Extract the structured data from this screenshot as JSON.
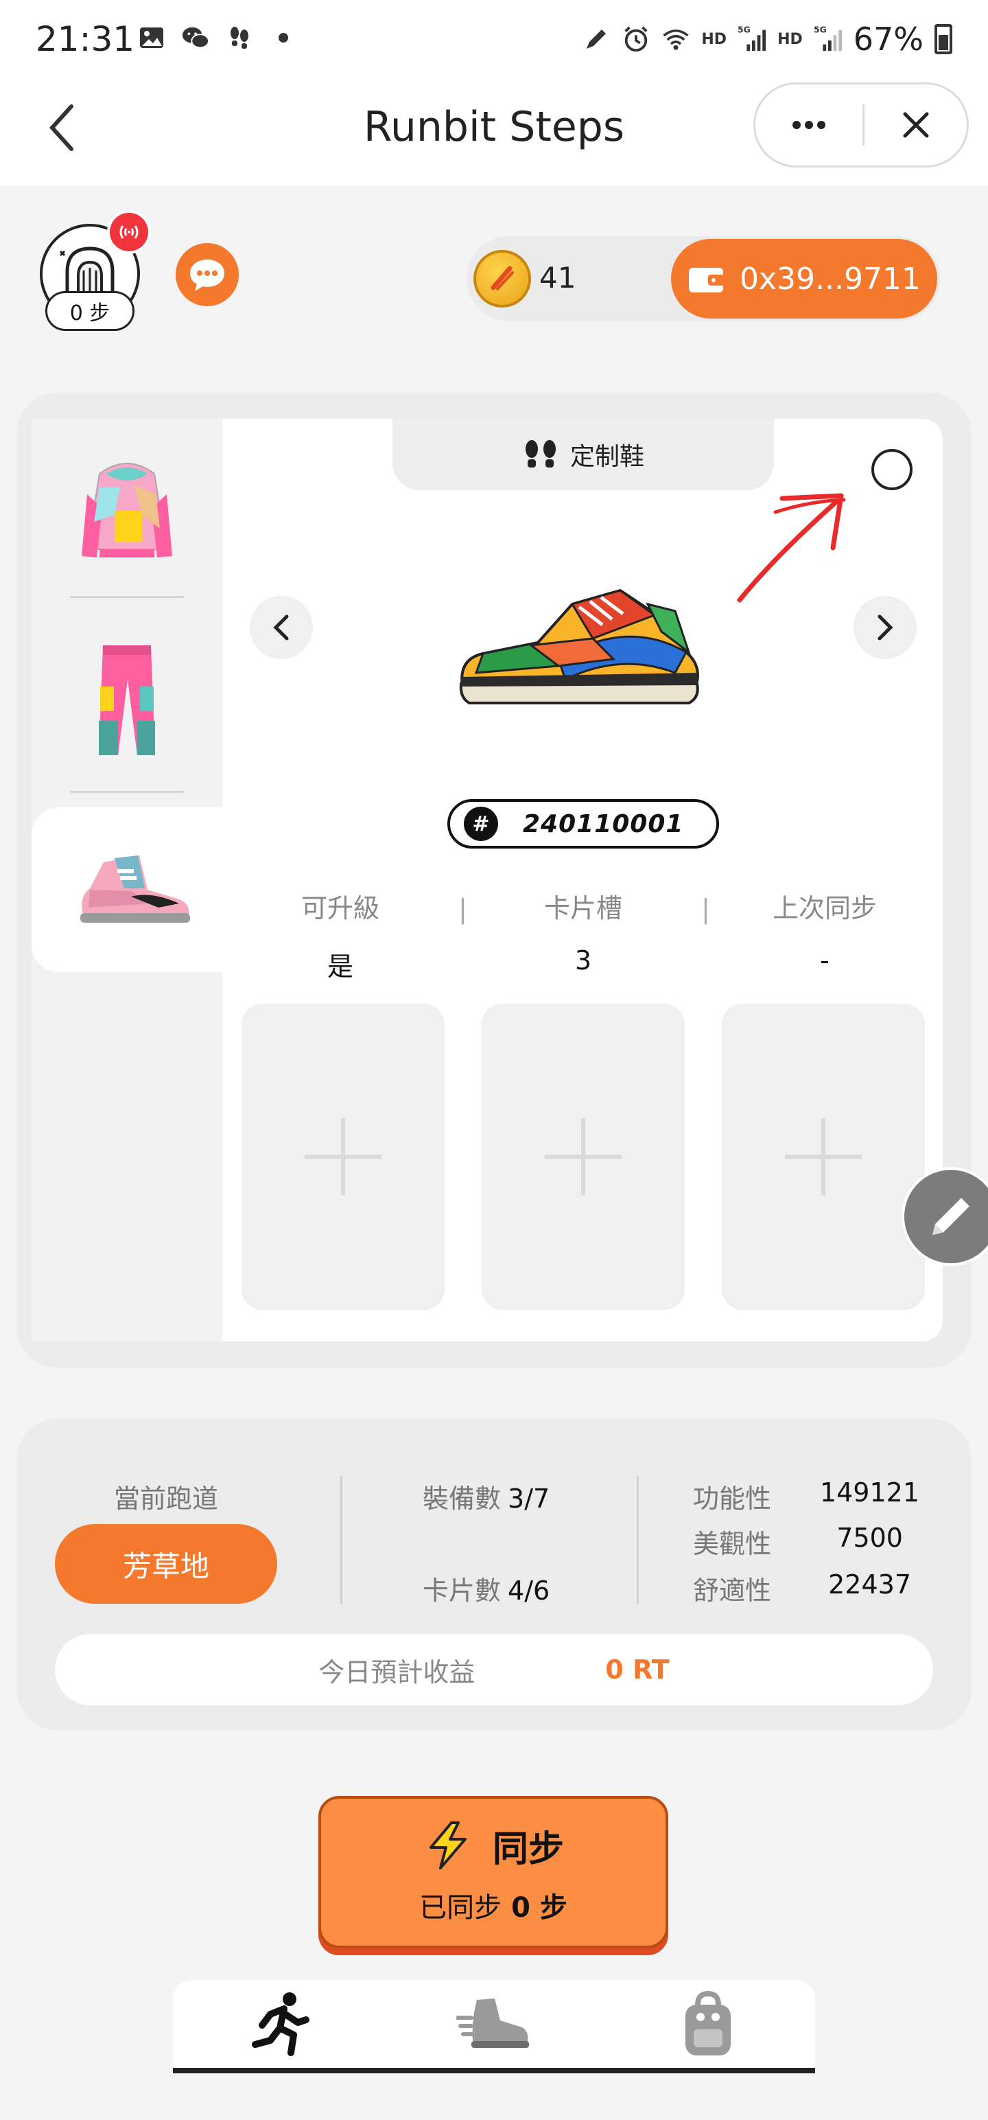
{
  "status_bar": {
    "time": "21:31",
    "network_tags": [
      "HD",
      "5G",
      "HD",
      "5G"
    ],
    "battery": "67%",
    "icons": [
      "image-icon",
      "wechat-icon",
      "footsteps-icon",
      "dot-icon",
      "pen-icon",
      "alarm-icon",
      "wifi-icon",
      "signal-icon",
      "battery-icon"
    ]
  },
  "navbar": {
    "title": "Runbit Steps",
    "back_icon": "chevron-left-icon",
    "more_icon": "more-dots-icon",
    "close_icon": "close-icon"
  },
  "profile": {
    "steps_label": "0 步",
    "coin_count": "41",
    "wallet_address": "0x39...9711"
  },
  "equipment": {
    "tab_label": "定制鞋",
    "id": "240110001",
    "side_items": [
      "hoodie",
      "pants",
      "sneaker"
    ],
    "active_item": 2,
    "stats": [
      {
        "label": "可升級",
        "value": "是"
      },
      {
        "label": "卡片槽",
        "value": "3"
      },
      {
        "label": "上次同步",
        "value": "-"
      }
    ],
    "stat_separator": "|",
    "card_slots": 3
  },
  "run_info": {
    "track_label": "當前跑道",
    "track_value": "芳草地",
    "equip_label": "裝備數",
    "equip_value": "3/7",
    "card_label": "卡片數",
    "card_value": "4/6",
    "attributes": [
      {
        "label": "功能性",
        "value": "149121"
      },
      {
        "label": "美觀性",
        "value": "7500"
      },
      {
        "label": "舒適性",
        "value": "22437"
      }
    ],
    "earn_label": "今日預計收益",
    "earn_value": "0 RT"
  },
  "sync": {
    "title": "同步",
    "synced_prefix": "已同步",
    "synced_value": "0 步"
  },
  "colors": {
    "accent": "#f5792d",
    "sync_button": "#fb8e43",
    "badge_red": "#f0353c"
  },
  "bottom_nav": [
    "runner-icon",
    "shoe-icon",
    "backpack-icon"
  ]
}
